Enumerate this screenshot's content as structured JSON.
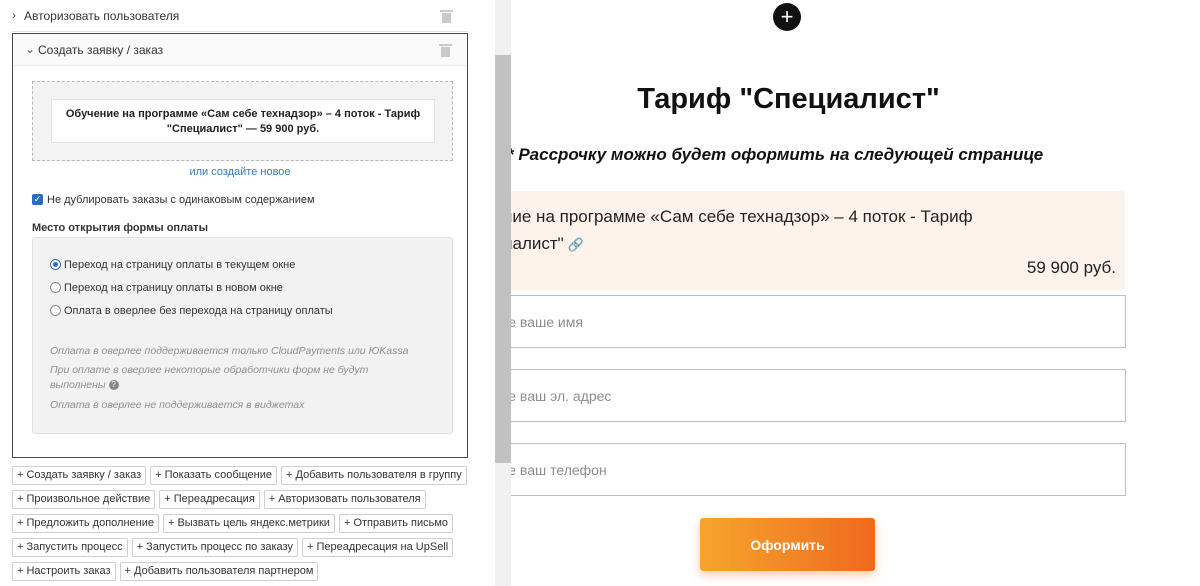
{
  "editor": {
    "collapsed_block": {
      "title": "Авторизовать пользователя"
    },
    "open_block": {
      "title": "Создать заявку / заказ",
      "product_line1": "Обучение на программе «Сам себе технадзор» – 4 поток - Тариф",
      "product_line2": "\"Специалист\" — 59 900 руб.",
      "create_new_link": "или создайте новое",
      "no_duplicate_checkbox": {
        "label": "Не дублировать заказы с одинаковым содержанием",
        "checked": true
      },
      "payment_form_label": "Место открытия формы оплаты",
      "radio_options": [
        {
          "label": "Переход на страницу оплаты в текущем окне",
          "selected": true
        },
        {
          "label": "Переход на страницу оплаты в новом окне",
          "selected": false
        },
        {
          "label": "Оплата в оверлее без перехода на страницу оплаты",
          "selected": false
        }
      ],
      "notes": [
        "Оплата в оверлее поддерживается только CloudPayments или ЮKassa",
        "При оплате в оверлее некоторые обработчики форм не будут выполнены",
        "Оплата в оверлее не поддерживается в виджетах"
      ]
    },
    "action_buttons": [
      [
        "+ Создать заявку / заказ",
        "+ Показать сообщение",
        "+ Добавить пользователя в группу"
      ],
      [
        "+ Произвольное действие",
        "+ Переадресация",
        "+ Авторизовать пользователя"
      ],
      [
        "+ Предложить дополнение",
        "+ Вызвать цель яндекс.метрики",
        "+ Отправить письмо"
      ],
      [
        "+ Запустить процесс",
        "+ Запустить процесс по заказу",
        "+ Переадресация на UpSell"
      ],
      [
        "+ Настроить заказ",
        "+ Добавить пользователя партнером"
      ]
    ]
  },
  "preview": {
    "title": "Тариф \"Специалист\"",
    "installment_note": "* Рассрочку  можно будет оформить на следующей странице",
    "order_line1": "ние на программе «Сам себе технадзор» – 4 поток - Тариф",
    "order_line2": "иалист\"",
    "order_price": "59 900 руб.",
    "fields": [
      {
        "placeholder": "те ваше имя"
      },
      {
        "placeholder": "те ваш эл. адрес"
      },
      {
        "placeholder": "те ваш телефон"
      }
    ],
    "submit_label": "Оформить"
  },
  "colors": {
    "accent_blue": "#2b6cc4",
    "order_card_bg": "#fdf3ea",
    "button_gradient_start": "#f6a52d",
    "button_gradient_end": "#ef6a1f"
  },
  "icons": [
    "chevron-right-icon",
    "chevron-down-icon",
    "trash-icon",
    "help-icon",
    "plus-circle-icon",
    "link-icon"
  ]
}
